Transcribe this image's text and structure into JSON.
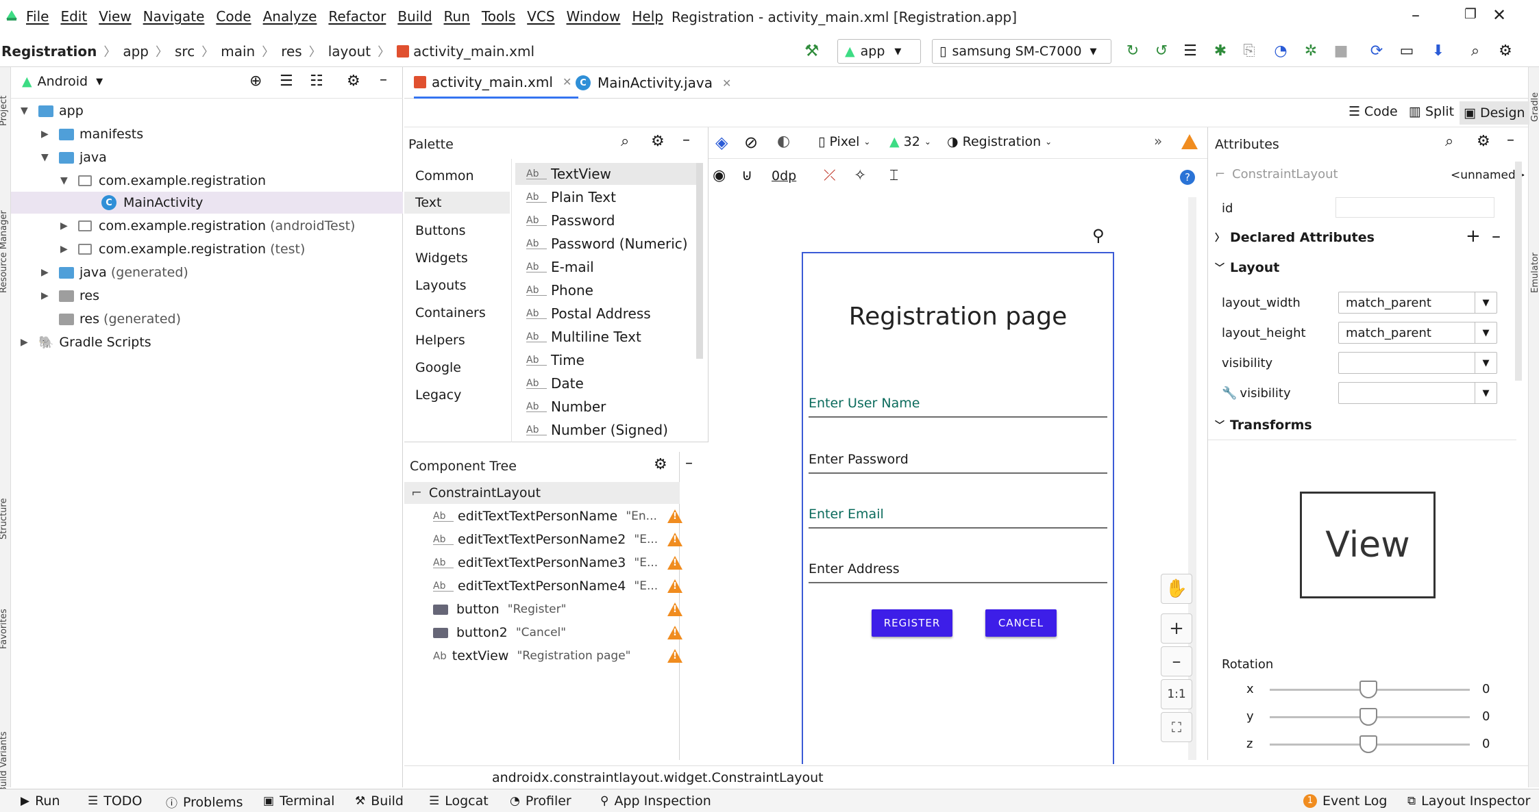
{
  "menubar": {
    "items": [
      "File",
      "Edit",
      "View",
      "Navigate",
      "Code",
      "Analyze",
      "Refactor",
      "Build",
      "Run",
      "Tools",
      "VCS",
      "Window",
      "Help"
    ],
    "window_title": "Registration - activity_main.xml [Registration.app]"
  },
  "breadcrumb": [
    "Registration",
    "app",
    "src",
    "main",
    "res",
    "layout",
    "activity_main.xml"
  ],
  "toolbar": {
    "config": "app",
    "device": "samsung SM-C7000"
  },
  "project": {
    "view": "Android",
    "tree": [
      {
        "label": "app",
        "suffix": ""
      },
      {
        "label": "manifests",
        "suffix": ""
      },
      {
        "label": "java",
        "suffix": ""
      },
      {
        "label": "com.example.registration",
        "suffix": ""
      },
      {
        "label": "MainActivity",
        "suffix": ""
      },
      {
        "label": "com.example.registration",
        "suffix": "(androidTest)"
      },
      {
        "label": "com.example.registration",
        "suffix": "(test)"
      },
      {
        "label": "java",
        "suffix": "(generated)"
      },
      {
        "label": "res",
        "suffix": ""
      },
      {
        "label": "res",
        "suffix": "(generated)"
      },
      {
        "label": "Gradle Scripts",
        "suffix": ""
      }
    ]
  },
  "side_labels": {
    "left": [
      "Project",
      "Resource Manager",
      "Structure",
      "Favorites",
      "Build Variants"
    ],
    "right": [
      "Gradle",
      "Emulator"
    ]
  },
  "tabs": [
    {
      "label": "activity_main.xml"
    },
    {
      "label": "MainActivity.java"
    }
  ],
  "view_modes": [
    "Code",
    "Split",
    "Design"
  ],
  "palette": {
    "title": "Palette",
    "categories": [
      "Common",
      "Text",
      "Buttons",
      "Widgets",
      "Layouts",
      "Containers",
      "Helpers",
      "Google",
      "Legacy"
    ],
    "items": [
      "TextView",
      "Plain Text",
      "Password",
      "Password (Numeric)",
      "E-mail",
      "Phone",
      "Postal Address",
      "Multiline Text",
      "Time",
      "Date",
      "Number",
      "Number (Signed)"
    ]
  },
  "design_toolbar": {
    "device": "Pixel",
    "api": "32",
    "theme": "Registration",
    "margin": "0dp"
  },
  "component_tree": {
    "title": "Component Tree",
    "root": "ConstraintLayout",
    "items": [
      {
        "name": "editTextTextPersonName",
        "hint": "\"En..."
      },
      {
        "name": "editTextTextPersonName2",
        "hint": "\"E..."
      },
      {
        "name": "editTextTextPersonName3",
        "hint": "\"E..."
      },
      {
        "name": "editTextTextPersonName4",
        "hint": "\"E..."
      },
      {
        "name": "button",
        "hint": "\"Register\""
      },
      {
        "name": "button2",
        "hint": "\"Cancel\""
      },
      {
        "name": "textView",
        "hint": "\"Registration page\""
      }
    ]
  },
  "preview": {
    "title": "Registration page",
    "fields": [
      "Enter User Name",
      "Enter Password",
      "Enter Email",
      "Enter Address"
    ],
    "register_label": "REGISTER",
    "cancel_label": "CANCEL"
  },
  "zoom": {
    "fit_label": "1:1"
  },
  "attributes": {
    "title": "Attributes",
    "component": "ConstraintLayout",
    "name": "<unnamed>",
    "id_label": "id",
    "declared": "Declared Attributes",
    "layout_section": "Layout",
    "rows": [
      {
        "label": "layout_width",
        "value": "match_parent"
      },
      {
        "label": "layout_height",
        "value": "match_parent"
      },
      {
        "label": "visibility",
        "value": ""
      },
      {
        "label": "visibility",
        "value": ""
      }
    ],
    "transforms": "Transforms",
    "view_label": "View",
    "rotation": "Rotation",
    "axes": [
      {
        "axis": "x",
        "value": "0"
      },
      {
        "axis": "y",
        "value": "0"
      },
      {
        "axis": "z",
        "value": "0"
      }
    ]
  },
  "status_path": "androidx.constraintlayout.widget.ConstraintLayout",
  "bottom_bar": {
    "left": [
      "Run",
      "TODO",
      "Problems",
      "Terminal",
      "Build",
      "Logcat",
      "Profiler",
      "App Inspection"
    ],
    "right": [
      "Event Log",
      "Layout Inspector"
    ]
  },
  "colors": {
    "accent": "#3574f0",
    "button": "#3d1ee8",
    "warning": "#f08c1f",
    "folder": "#4f9fd9",
    "android": "#3ddc84"
  }
}
